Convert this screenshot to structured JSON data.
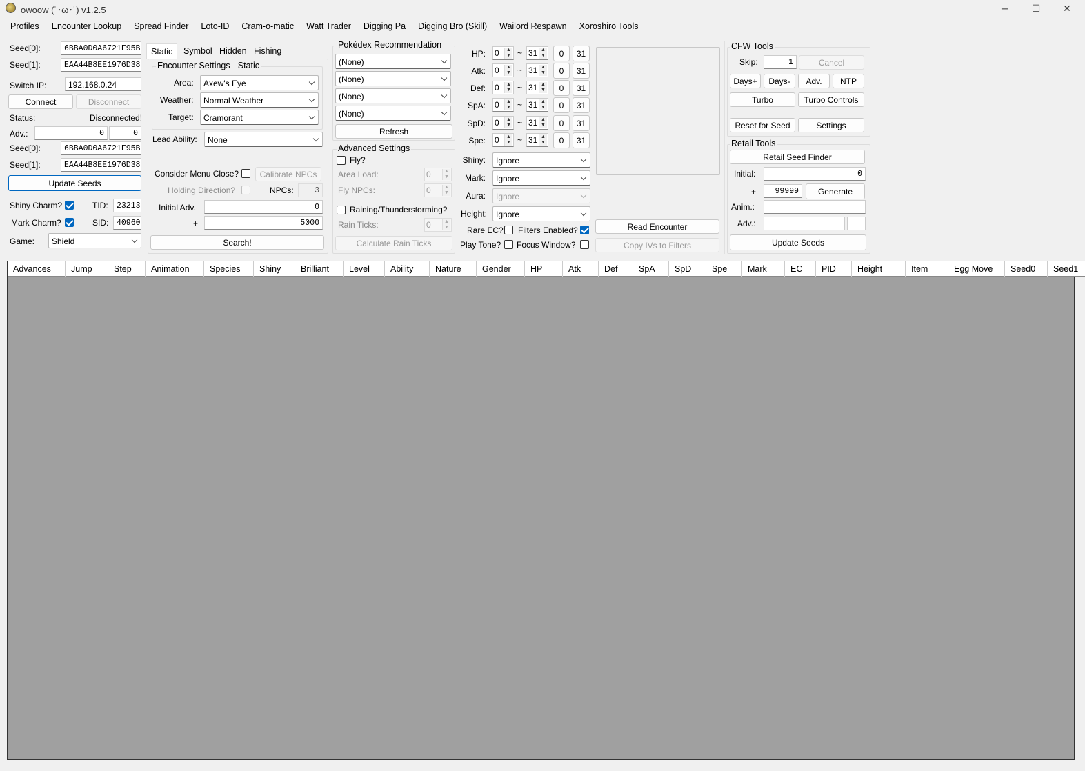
{
  "window": {
    "title": "owoow (˙･ω･˙) v1.2.5",
    "minimize": "─",
    "maximize": "☐",
    "close": "✕"
  },
  "menu": [
    "Profiles",
    "Encounter Lookup",
    "Spread Finder",
    "Loto-ID",
    "Cram-o-matic",
    "Watt Trader",
    "Digging Pa",
    "Digging Bro (Skill)",
    "Wailord Respawn",
    "Xoroshiro Tools"
  ],
  "connection": {
    "seed0_label": "Seed[0]:",
    "seed0": "6BBA0D0A6721F95B",
    "seed1_label": "Seed[1]:",
    "seed1": "EAA44B8EE1976D38",
    "switch_ip_label": "Switch IP:",
    "switch_ip": "192.168.0.24",
    "connect": "Connect",
    "disconnect": "Disconnect",
    "status_label": "Status:",
    "status": "Disconnected!",
    "adv_label": "Adv.:",
    "adv_a": "0",
    "adv_b": "0",
    "cur_seed0_label": "Seed[0]:",
    "cur_seed0": "6BBA0D0A6721F95B",
    "cur_seed1_label": "Seed[1]:",
    "cur_seed1": "EAA44B8EE1976D38",
    "update_seeds": "Update Seeds",
    "shiny_charm_label": "Shiny Charm?",
    "shiny_charm": true,
    "mark_charm_label": "Mark Charm?",
    "mark_charm": true,
    "tid_label": "TID:",
    "tid": "23213",
    "sid_label": "SID:",
    "sid": "40960",
    "game_label": "Game:",
    "game": "Shield"
  },
  "encounter": {
    "tabs": [
      "Static",
      "Symbol",
      "Hidden",
      "Fishing"
    ],
    "selected_tab": "Static",
    "group_title": "Encounter Settings - Static",
    "area_label": "Area:",
    "area": "Axew's Eye",
    "weather_label": "Weather:",
    "weather": "Normal Weather",
    "target_label": "Target:",
    "target": "Cramorant",
    "lead_label": "Lead Ability:",
    "lead": "None",
    "menu_close_label": "Consider Menu Close?",
    "calibrate": "Calibrate NPCs",
    "holding_label": "Holding Direction?",
    "npcs_label": "NPCs:",
    "npcs": "3",
    "initial_adv_label": "Initial Adv.",
    "initial_adv": "0",
    "plus_label": "+",
    "plus": "5000",
    "search": "Search!"
  },
  "pokedex": {
    "title": "Pokédex Recommendation",
    "slots": [
      "(None)",
      "(None)",
      "(None)",
      "(None)"
    ],
    "refresh": "Refresh"
  },
  "advanced": {
    "title": "Advanced Settings",
    "fly_label": "Fly?",
    "area_load_label": "Area Load:",
    "area_load": "0",
    "fly_npcs_label": "Fly NPCs:",
    "fly_npcs": "0",
    "raining_label": "Raining/Thunderstorming?",
    "rain_ticks_label": "Rain Ticks:",
    "rain_ticks": "0",
    "calc_rain": "Calculate Rain Ticks"
  },
  "filters": {
    "ivs": [
      {
        "label": "HP:",
        "min": "0",
        "max": "31",
        "b0": "0",
        "b31": "31"
      },
      {
        "label": "Atk:",
        "min": "0",
        "max": "31",
        "b0": "0",
        "b31": "31"
      },
      {
        "label": "Def:",
        "min": "0",
        "max": "31",
        "b0": "0",
        "b31": "31"
      },
      {
        "label": "SpA:",
        "min": "0",
        "max": "31",
        "b0": "0",
        "b31": "31"
      },
      {
        "label": "SpD:",
        "min": "0",
        "max": "31",
        "b0": "0",
        "b31": "31"
      },
      {
        "label": "Spe:",
        "min": "0",
        "max": "31",
        "b0": "0",
        "b31": "31"
      }
    ],
    "tilde": "~",
    "shiny_label": "Shiny:",
    "shiny": "Ignore",
    "mark_label": "Mark:",
    "mark": "Ignore",
    "aura_label": "Aura:",
    "aura": "Ignore",
    "height_label": "Height:",
    "height": "Ignore",
    "rare_ec_label": "Rare EC?",
    "filters_enabled_label": "Filters Enabled?",
    "filters_enabled": true,
    "play_tone_label": "Play Tone?",
    "focus_window_label": "Focus Window?"
  },
  "preview": {
    "read_encounter": "Read Encounter",
    "copy_ivs": "Copy IVs to Filters"
  },
  "cfw": {
    "title": "CFW Tools",
    "skip_label": "Skip:",
    "skip": "1",
    "cancel": "Cancel",
    "days_plus": "Days+",
    "days_minus": "Days-",
    "adv": "Adv.",
    "ntp": "NTP",
    "turbo": "Turbo",
    "turbo_controls": "Turbo Controls",
    "reset_for_seed": "Reset for Seed",
    "settings": "Settings"
  },
  "retail": {
    "title": "Retail Tools",
    "finder": "Retail Seed Finder",
    "initial_label": "Initial:",
    "initial": "0",
    "plus_label": "+",
    "plus": "99999",
    "generate": "Generate",
    "anim_label": "Anim.:",
    "adv_label": "Adv.:",
    "update_seeds": "Update Seeds"
  },
  "grid": {
    "columns": [
      "Advances",
      "Jump",
      "Step",
      "Animation",
      "Species",
      "Shiny",
      "Brilliant",
      "Level",
      "Ability",
      "Nature",
      "Gender",
      "HP",
      "Atk",
      "Def",
      "SpA",
      "SpD",
      "Spe",
      "Mark",
      "EC",
      "PID",
      "Height",
      "Item",
      "Egg Move",
      "Seed0",
      "Seed1"
    ],
    "background": "#a0a0a0"
  }
}
